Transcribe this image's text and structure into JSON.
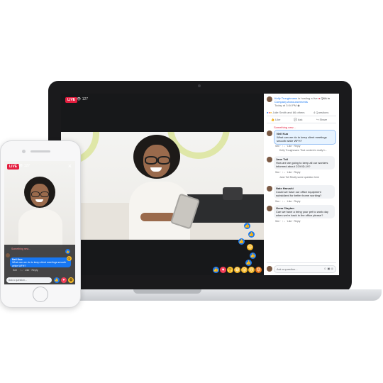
{
  "laptop": {
    "video": {
      "live_label": "LIVE",
      "viewer_count": "127"
    },
    "post": {
      "author": "Kelly Troughmann",
      "action_text": "is hosting a live",
      "event_title": "Q&A in",
      "group": "Company Announcements",
      "timestamp": "Today at 3:04 PM",
      "reactions_text": "Julie Smith and 86 others",
      "questions_count": "4 Questions",
      "like_label": "Like",
      "ask_label": "Ask",
      "share_label": "Share"
    },
    "comments": [
      {
        "tag": "Something new...",
        "author": "Neil Kuo",
        "text": "What can we do to keep client meetings smooth while WFH?",
        "actions": [
          "See",
          "↑",
          "↓",
          "Like",
          "Reply"
        ],
        "reply": "Kelly Troughmann  That content is really h..."
      },
      {
        "author": "Jane Toll",
        "text": "How are we going to keep all our workers informed about COVID-19?",
        "actions": [
          "See",
          "↑",
          "↓",
          "Like",
          "Reply"
        ],
        "reply": "Jane Toll Really some question here"
      },
      {
        "author": "Nate Harushi",
        "text": "Could we have our office equipment subsidized for better home working?",
        "actions": [
          "See",
          "↑",
          "↓",
          "Like",
          "Reply"
        ]
      },
      {
        "author": "Gena Clayton",
        "text": "Can we have a bring your pet to work day when we're back in the office please?",
        "actions": [
          "See",
          "↑",
          "↓",
          "Like",
          "Reply"
        ]
      }
    ],
    "input_placeholder": "Ask a question...",
    "colors": {
      "live_red": "#e41e3f",
      "fb_blue": "#1877f2",
      "reaction_yellow": "#f7b928",
      "love_red": "#f33e58"
    }
  },
  "phone": {
    "live_label": "LIVE",
    "viewer_count": "127",
    "tag": "Something new...",
    "author": "Neil Kuo",
    "question": "What can we do to keep client meetings smooth while WFH?",
    "actions": [
      "See",
      "↑",
      "↓",
      "Like",
      "Reply"
    ],
    "input_placeholder": "Ask a question...",
    "close_icon": "close-icon"
  }
}
